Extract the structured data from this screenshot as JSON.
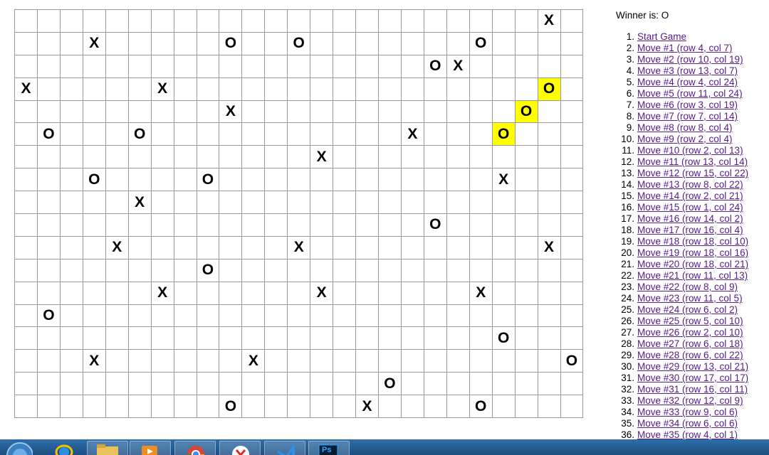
{
  "status": "Winner is: O",
  "board": {
    "rows": 18,
    "cols": 25,
    "marks": [
      {
        "r": 0,
        "c": 23,
        "v": "X"
      },
      {
        "r": 1,
        "c": 3,
        "v": "X"
      },
      {
        "r": 1,
        "c": 9,
        "v": "O"
      },
      {
        "r": 1,
        "c": 12,
        "v": "O"
      },
      {
        "r": 1,
        "c": 20,
        "v": "O"
      },
      {
        "r": 2,
        "c": 18,
        "v": "O"
      },
      {
        "r": 2,
        "c": 19,
        "v": "X"
      },
      {
        "r": 3,
        "c": 0,
        "v": "X"
      },
      {
        "r": 3,
        "c": 6,
        "v": "X"
      },
      {
        "r": 3,
        "c": 23,
        "v": "O",
        "hl": true
      },
      {
        "r": 4,
        "c": 9,
        "v": "X"
      },
      {
        "r": 4,
        "c": 22,
        "v": "O",
        "hl": true
      },
      {
        "r": 5,
        "c": 1,
        "v": "O"
      },
      {
        "r": 5,
        "c": 5,
        "v": "O"
      },
      {
        "r": 5,
        "c": 17,
        "v": "X"
      },
      {
        "r": 5,
        "c": 21,
        "v": "O",
        "hl": true
      },
      {
        "r": 6,
        "c": 13,
        "v": "X"
      },
      {
        "r": 7,
        "c": 3,
        "v": "O"
      },
      {
        "r": 7,
        "c": 8,
        "v": "O"
      },
      {
        "r": 7,
        "c": 21,
        "v": "X"
      },
      {
        "r": 8,
        "c": 5,
        "v": "X"
      },
      {
        "r": 9,
        "c": 18,
        "v": "O"
      },
      {
        "r": 10,
        "c": 4,
        "v": "X"
      },
      {
        "r": 10,
        "c": 12,
        "v": "X"
      },
      {
        "r": 10,
        "c": 23,
        "v": "X"
      },
      {
        "r": 11,
        "c": 8,
        "v": "O"
      },
      {
        "r": 12,
        "c": 6,
        "v": "X"
      },
      {
        "r": 12,
        "c": 13,
        "v": "X"
      },
      {
        "r": 12,
        "c": 20,
        "v": "X"
      },
      {
        "r": 13,
        "c": 1,
        "v": "O"
      },
      {
        "r": 14,
        "c": 21,
        "v": "O"
      },
      {
        "r": 15,
        "c": 3,
        "v": "X"
      },
      {
        "r": 15,
        "c": 10,
        "v": "X"
      },
      {
        "r": 15,
        "c": 24,
        "v": "O"
      },
      {
        "r": 16,
        "c": 16,
        "v": "O"
      },
      {
        "r": 17,
        "c": 9,
        "v": "O"
      },
      {
        "r": 17,
        "c": 15,
        "v": "X"
      },
      {
        "r": 17,
        "c": 20,
        "v": "O"
      }
    ]
  },
  "moves": [
    {
      "num": "1.",
      "label": "Start Game"
    },
    {
      "num": "2.",
      "label": "Move #1 (row 4, col 7)"
    },
    {
      "num": "3.",
      "label": "Move #2 (row 10, col 19)"
    },
    {
      "num": "4.",
      "label": "Move #3 (row 13, col 7)"
    },
    {
      "num": "5.",
      "label": "Move #4 (row 4, col 24)"
    },
    {
      "num": "6.",
      "label": "Move #5 (row 11, col 24)"
    },
    {
      "num": "7.",
      "label": "Move #6 (row 3, col 19)"
    },
    {
      "num": "8.",
      "label": "Move #7 (row 7, col 14)"
    },
    {
      "num": "9.",
      "label": "Move #8 (row 8, col 4)"
    },
    {
      "num": "10.",
      "label": "Move #9 (row 2, col 4)"
    },
    {
      "num": "11.",
      "label": "Move #10 (row 2, col 13)"
    },
    {
      "num": "12.",
      "label": "Move #11 (row 13, col 14)"
    },
    {
      "num": "13.",
      "label": "Move #12 (row 15, col 22)"
    },
    {
      "num": "14.",
      "label": "Move #13 (row 8, col 22)"
    },
    {
      "num": "15.",
      "label": "Move #14 (row 2, col 21)"
    },
    {
      "num": "16.",
      "label": "Move #15 (row 1, col 24)"
    },
    {
      "num": "17.",
      "label": "Move #16 (row 14, col 2)"
    },
    {
      "num": "18.",
      "label": "Move #17 (row 16, col 4)"
    },
    {
      "num": "19.",
      "label": "Move #18 (row 18, col 10)"
    },
    {
      "num": "20.",
      "label": "Move #19 (row 18, col 16)"
    },
    {
      "num": "21.",
      "label": "Move #20 (row 18, col 21)"
    },
    {
      "num": "22.",
      "label": "Move #21 (row 11, col 13)"
    },
    {
      "num": "23.",
      "label": "Move #22 (row 8, col 9)"
    },
    {
      "num": "24.",
      "label": "Move #23 (row 11, col 5)"
    },
    {
      "num": "25.",
      "label": "Move #24 (row 6, col 2)"
    },
    {
      "num": "26.",
      "label": "Move #25 (row 5, col 10)"
    },
    {
      "num": "27.",
      "label": "Move #26 (row 2, col 10)"
    },
    {
      "num": "28.",
      "label": "Move #27 (row 6, col 18)"
    },
    {
      "num": "29.",
      "label": "Move #28 (row 6, col 22)"
    },
    {
      "num": "30.",
      "label": "Move #29 (row 13, col 21)"
    },
    {
      "num": "31.",
      "label": "Move #30 (row 17, col 17)"
    },
    {
      "num": "32.",
      "label": "Move #31 (row 16, col 11)"
    },
    {
      "num": "33.",
      "label": "Move #32 (row 12, col 9)"
    },
    {
      "num": "34.",
      "label": "Move #33 (row 9, col 6)"
    },
    {
      "num": "35.",
      "label": "Move #34 (row 6, col 6)"
    },
    {
      "num": "36.",
      "label": "Move #35 (row 4, col 1)"
    }
  ],
  "taskbar": {
    "items": [
      "start-button-icon",
      "ie-icon",
      "folder-icon",
      "media-player-icon",
      "chrome-icon",
      "yandex-icon",
      "vscode-icon",
      "photoshop-icon"
    ],
    "photoshop_label": "Ps"
  }
}
